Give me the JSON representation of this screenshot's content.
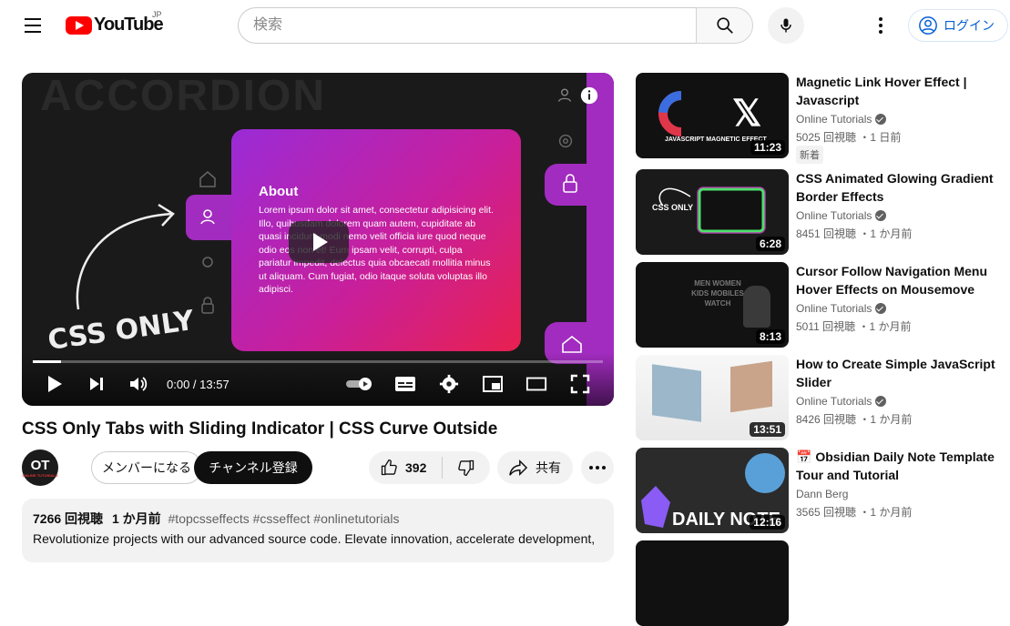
{
  "header": {
    "logo_text": "YouTube",
    "region": "JP",
    "search_placeholder": "検索",
    "login_label": "ログイン"
  },
  "player": {
    "overlay_word": "ACCORDION",
    "card_heading": "About",
    "card_body": "Lorem ipsum dolor sit amet, consectetur adipisicing elit. Illo, quibusdam dolorem quam autem, cupiditate ab quasi incidunt modi nemo velit officia iure quod neque odio eos non et! Eum ipsam velit, corrupti, culpa pariatur impedit, delectus quia obcaecati mollitia minus ut aliquam. Cum fugiat, odio itaque soluta voluptas illo adipisci.",
    "css_only_text": "CSS ONLY",
    "time": "0:00 / 13:57",
    "progress_fraction": 0.05
  },
  "video": {
    "title": "CSS Only Tabs with Sliding Indicator | CSS Curve Outside",
    "channel_avatar_text": "OT",
    "channel_avatar_sub": "ONLINE TUTORIALS",
    "member_label": "メンバーになる",
    "subscribe_label": "チャンネル登録",
    "likes": "392",
    "share_label": "共有",
    "views": "7266 回視聴",
    "posted": "1 か月前",
    "tags": "#topcsseffects #csseffect #onlinetutorials",
    "description": "Revolutionize projects with our advanced source code. Elevate innovation, accelerate development,"
  },
  "recommendations": [
    {
      "title": "Magnetic Link Hover Effect | Javascript",
      "channel": "Online Tutorials",
      "verified": true,
      "meta": "5025 回視聴 ・1 日前",
      "badge": "新着",
      "duration": "11:23",
      "thumb_text": "JAVASCRIPT MAGNETIC EFFECT"
    },
    {
      "title": "CSS Animated Glowing Gradient Border Effects",
      "channel": "Online Tutorials",
      "verified": true,
      "meta": "8451 回視聴 ・1 か月前",
      "badge": "",
      "duration": "6:28",
      "thumb_text": "CSS ONLY"
    },
    {
      "title": "Cursor Follow Navigation Menu Hover Effects on Mousemove",
      "channel": "Online Tutorials",
      "verified": true,
      "meta": "5011 回視聴 ・1 か月前",
      "badge": "",
      "duration": "8:13",
      "thumb_text": "MEN WOMEN KIDS MOBILES WATCH"
    },
    {
      "title": "How to Create Simple JavaScript Slider",
      "channel": "Online Tutorials",
      "verified": true,
      "meta": "8426 回視聴 ・1 か月前",
      "badge": "",
      "duration": "13:51",
      "thumb_text": ""
    },
    {
      "title": "📅 Obsidian Daily Note Template Tour and Tutorial",
      "channel": "Dann Berg",
      "verified": false,
      "meta": "3565 回視聴 ・1 か月前",
      "badge": "",
      "duration": "12:16",
      "thumb_text": "DAILY NOTE"
    }
  ]
}
